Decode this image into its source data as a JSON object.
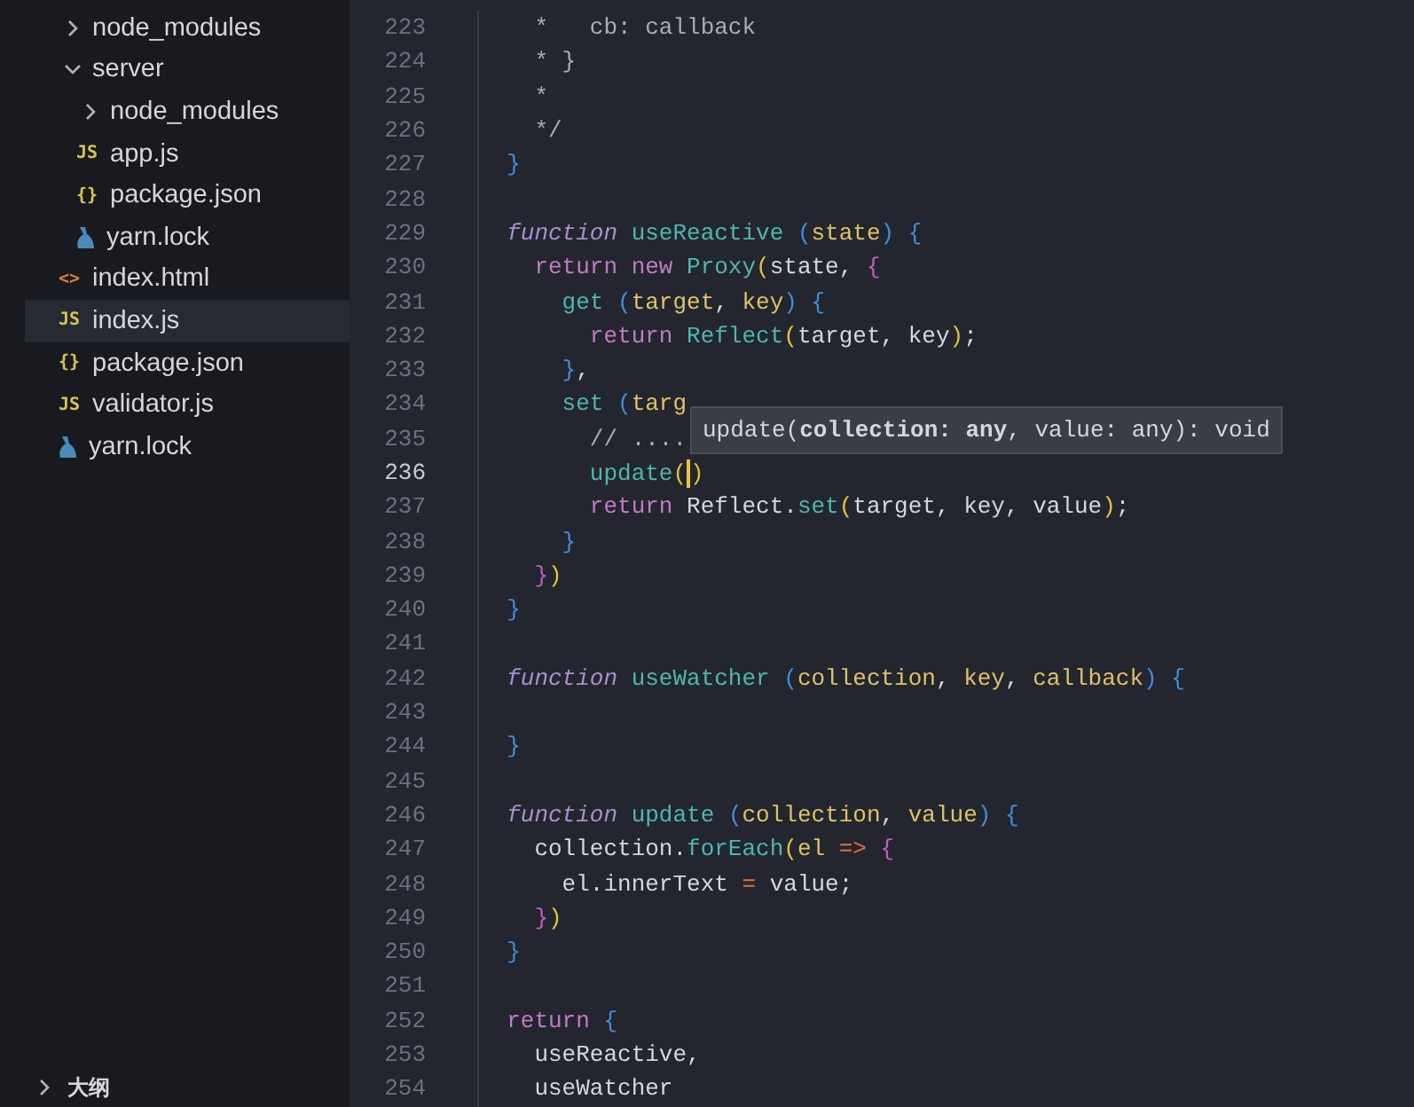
{
  "explorer": {
    "items": [
      {
        "label": "node_modules",
        "kind": "folder",
        "expanded": false,
        "selected": false
      },
      {
        "label": "server",
        "kind": "folder",
        "expanded": true,
        "selected": false,
        "children": [
          {
            "label": "node_modules",
            "kind": "folder",
            "expanded": false,
            "selected": false
          },
          {
            "label": "app.js",
            "kind": "js",
            "icon": "JS",
            "selected": false
          },
          {
            "label": "package.json",
            "kind": "json",
            "icon": "{}",
            "selected": false
          },
          {
            "label": "yarn.lock",
            "kind": "yarn",
            "selected": false
          }
        ]
      },
      {
        "label": "index.html",
        "kind": "html",
        "icon": "<>",
        "selected": false
      },
      {
        "label": "index.js",
        "kind": "js",
        "icon": "JS",
        "selected": true
      },
      {
        "label": "package.json",
        "kind": "json",
        "icon": "{}",
        "selected": false
      },
      {
        "label": "validator.js",
        "kind": "js",
        "icon": "JS",
        "selected": false
      },
      {
        "label": "yarn.lock",
        "kind": "yarn",
        "selected": false
      }
    ],
    "outline": {
      "label": "大纲",
      "expanded": false
    }
  },
  "editor": {
    "lines": [
      {
        "number": "223",
        "current": false,
        "tokens": [
          {
            "kind": "comment",
            "text": "    *   cb: callback"
          }
        ]
      },
      {
        "number": "224",
        "current": false,
        "tokens": [
          {
            "kind": "comment",
            "text": "    * }"
          }
        ]
      },
      {
        "number": "225",
        "current": false,
        "tokens": [
          {
            "kind": "comment",
            "text": "    *"
          }
        ]
      },
      {
        "number": "226",
        "current": false,
        "tokens": [
          {
            "kind": "comment",
            "text": "    */"
          }
        ]
      },
      {
        "number": "227",
        "current": false,
        "tokens": [
          {
            "kind": "bracket1",
            "text": "  }"
          }
        ]
      },
      {
        "number": "228",
        "current": false
      },
      {
        "number": "229",
        "current": false,
        "tokens": [
          {
            "kind": "storage",
            "text": "  function"
          },
          {
            "kind": "function",
            "text": " useReactive "
          },
          {
            "kind": "bracket1",
            "text": "("
          },
          {
            "kind": "param",
            "text": "state"
          },
          {
            "kind": "bracket1",
            "text": ")"
          },
          {
            "kind": "bracket1",
            "text": " {"
          }
        ]
      },
      {
        "number": "230",
        "current": false,
        "tokens": [
          {
            "kind": "keyword",
            "text": "    return new"
          },
          {
            "kind": "function",
            "text": " Proxy"
          },
          {
            "kind": "bracket3",
            "text": "("
          },
          {
            "kind": "plain",
            "text": "state, "
          },
          {
            "kind": "bracket2",
            "text": "{"
          }
        ]
      },
      {
        "number": "231",
        "current": false,
        "tokens": [
          {
            "kind": "function",
            "text": "      get "
          },
          {
            "kind": "bracket1",
            "text": "("
          },
          {
            "kind": "param",
            "text": "target"
          },
          {
            "kind": "plain",
            "text": ", "
          },
          {
            "kind": "param",
            "text": "key"
          },
          {
            "kind": "bracket1",
            "text": ")"
          },
          {
            "kind": "bracket1",
            "text": " {"
          }
        ]
      },
      {
        "number": "232",
        "current": false,
        "tokens": [
          {
            "kind": "keyword",
            "text": "        return"
          },
          {
            "kind": "function",
            "text": " Reflect"
          },
          {
            "kind": "bracket3",
            "text": "("
          },
          {
            "kind": "plain",
            "text": "target, key"
          },
          {
            "kind": "bracket3",
            "text": ")"
          },
          {
            "kind": "plain",
            "text": ";"
          }
        ]
      },
      {
        "number": "233",
        "current": false,
        "tokens": [
          {
            "kind": "bracket1",
            "text": "      }"
          },
          {
            "kind": "plain",
            "text": ","
          }
        ]
      },
      {
        "number": "234",
        "current": false,
        "tokens": [
          {
            "kind": "function",
            "text": "      set "
          },
          {
            "kind": "bracket1",
            "text": "("
          },
          {
            "kind": "param",
            "text": "targ"
          }
        ]
      },
      {
        "number": "235",
        "current": false,
        "tokens": [
          {
            "kind": "comment",
            "text": "        // ...."
          }
        ]
      },
      {
        "number": "236",
        "current": true,
        "tokens": [
          {
            "kind": "function",
            "text": "        update"
          },
          {
            "kind": "bracket3",
            "text": "(",
            "caret_after": true
          },
          {
            "kind": "bracket3",
            "text": ")"
          }
        ]
      },
      {
        "number": "237",
        "current": false,
        "tokens": [
          {
            "kind": "keyword",
            "text": "        return"
          },
          {
            "kind": "plain",
            "text": " Reflect."
          },
          {
            "kind": "function",
            "text": "set"
          },
          {
            "kind": "bracket3",
            "text": "("
          },
          {
            "kind": "plain",
            "text": "target, key, value"
          },
          {
            "kind": "bracket3",
            "text": ")"
          },
          {
            "kind": "plain",
            "text": ";"
          }
        ]
      },
      {
        "number": "238",
        "current": false,
        "tokens": [
          {
            "kind": "bracket1",
            "text": "      }"
          }
        ]
      },
      {
        "number": "239",
        "current": false,
        "tokens": [
          {
            "kind": "bracket2",
            "text": "    }"
          },
          {
            "kind": "bracket3",
            "text": ")"
          }
        ]
      },
      {
        "number": "240",
        "current": false,
        "tokens": [
          {
            "kind": "bracket1",
            "text": "  }"
          }
        ]
      },
      {
        "number": "241",
        "current": false
      },
      {
        "number": "242",
        "current": false,
        "tokens": [
          {
            "kind": "storage",
            "text": "  function"
          },
          {
            "kind": "function",
            "text": " useWatcher "
          },
          {
            "kind": "bracket1",
            "text": "("
          },
          {
            "kind": "param",
            "text": "collection"
          },
          {
            "kind": "plain",
            "text": ", "
          },
          {
            "kind": "param",
            "text": "key"
          },
          {
            "kind": "plain",
            "text": ", "
          },
          {
            "kind": "param",
            "text": "callback"
          },
          {
            "kind": "bracket1",
            "text": ")"
          },
          {
            "kind": "bracket1",
            "text": " {"
          }
        ]
      },
      {
        "number": "243",
        "current": false
      },
      {
        "number": "244",
        "current": false,
        "tokens": [
          {
            "kind": "bracket1",
            "text": "  }"
          }
        ]
      },
      {
        "number": "245",
        "current": false
      },
      {
        "number": "246",
        "current": false,
        "tokens": [
          {
            "kind": "storage",
            "text": "  function"
          },
          {
            "kind": "function",
            "text": " update "
          },
          {
            "kind": "bracket1",
            "text": "("
          },
          {
            "kind": "param",
            "text": "collection"
          },
          {
            "kind": "plain",
            "text": ", "
          },
          {
            "kind": "param",
            "text": "value"
          },
          {
            "kind": "bracket1",
            "text": ")"
          },
          {
            "kind": "bracket1",
            "text": " {"
          }
        ]
      },
      {
        "number": "247",
        "current": false,
        "tokens": [
          {
            "kind": "plain",
            "text": "    collection."
          },
          {
            "kind": "function",
            "text": "forEach"
          },
          {
            "kind": "bracket3",
            "text": "("
          },
          {
            "kind": "param",
            "text": "el"
          },
          {
            "kind": "operator",
            "text": " =>"
          },
          {
            "kind": "bracket2",
            "text": " {"
          }
        ]
      },
      {
        "number": "248",
        "current": false,
        "tokens": [
          {
            "kind": "plain",
            "text": "      el.innerText "
          },
          {
            "kind": "operator",
            "text": "="
          },
          {
            "kind": "plain",
            "text": " value;"
          }
        ]
      },
      {
        "number": "249",
        "current": false,
        "tokens": [
          {
            "kind": "bracket2",
            "text": "    }"
          },
          {
            "kind": "bracket3",
            "text": ")"
          }
        ]
      },
      {
        "number": "250",
        "current": false,
        "tokens": [
          {
            "kind": "bracket1",
            "text": "  }"
          }
        ]
      },
      {
        "number": "251",
        "current": false
      },
      {
        "number": "252",
        "current": false,
        "tokens": [
          {
            "kind": "keyword",
            "text": "  return"
          },
          {
            "kind": "bracket1",
            "text": " {"
          }
        ]
      },
      {
        "number": "253",
        "current": false,
        "tokens": [
          {
            "kind": "plain",
            "text": "    useReactive,"
          }
        ]
      },
      {
        "number": "254",
        "current": false,
        "tokens": [
          {
            "kind": "plain",
            "text": "    useWatcher"
          }
        ]
      }
    ],
    "hover": {
      "text": "update(**collection: any**, value: any): void"
    }
  }
}
